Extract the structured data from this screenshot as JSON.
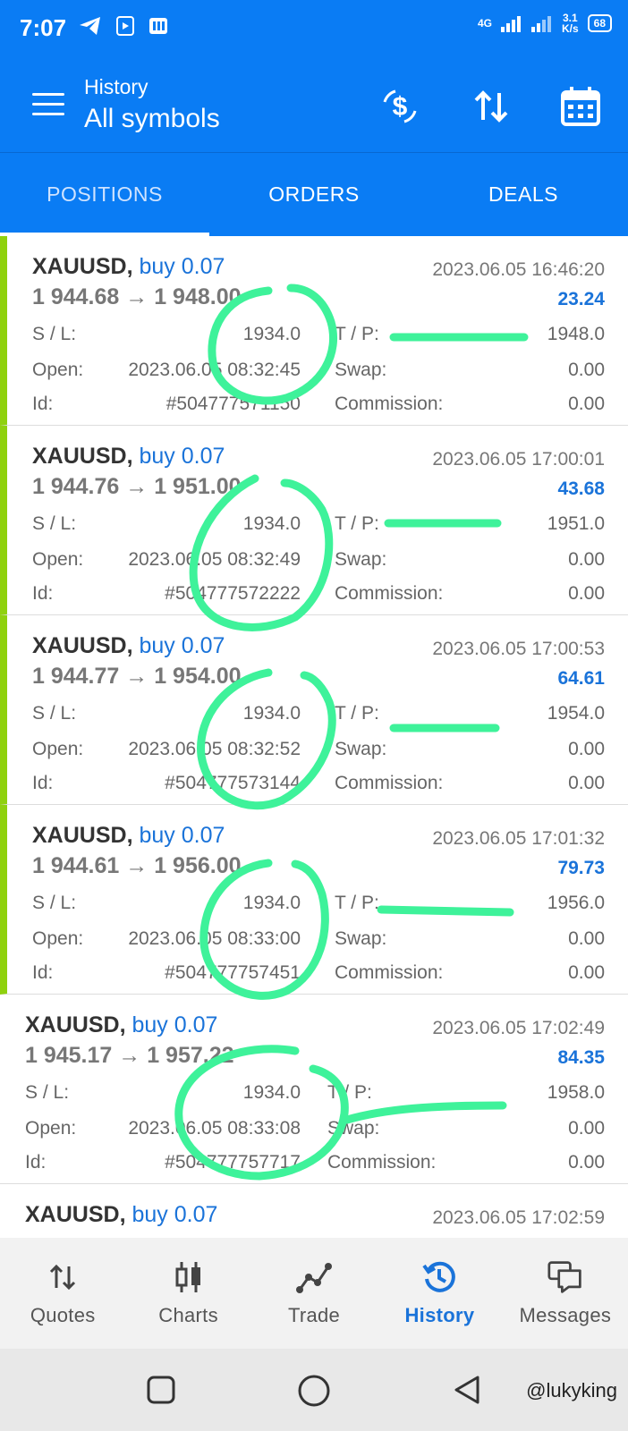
{
  "status_bar": {
    "time": "7:07",
    "signal": "4G",
    "net_speed_value": "3.1",
    "net_speed_unit": "K/s",
    "battery": "68"
  },
  "app_bar": {
    "subtitle": "History",
    "title": "All symbols"
  },
  "tabs": [
    {
      "label": "POSITIONS"
    },
    {
      "label": "ORDERS"
    },
    {
      "label": "DEALS"
    }
  ],
  "labels": {
    "sl": "S / L:",
    "tp": "T / P:",
    "open": "Open:",
    "swap": "Swap:",
    "id": "Id:",
    "commission": "Commission:"
  },
  "positions": [
    {
      "symbol": "XAUUSD,",
      "direction": "buy 0.07",
      "close_date": "2023.06.05 16:46:20",
      "prices": "1 944.68 → 1 948.00",
      "profit": "23.24",
      "sl": "1934.0",
      "tp": "1948.0",
      "open": "2023.06.05 08:32:45",
      "swap": "0.00",
      "id": "#504777571150",
      "commission": "0.00"
    },
    {
      "symbol": "XAUUSD,",
      "direction": "buy 0.07",
      "close_date": "2023.06.05 17:00:01",
      "prices": "1 944.76 → 1 951.00",
      "profit": "43.68",
      "sl": "1934.0",
      "tp": "1951.0",
      "open": "2023.06.05 08:32:49",
      "swap": "0.00",
      "id": "#504777572222",
      "commission": "0.00"
    },
    {
      "symbol": "XAUUSD,",
      "direction": "buy 0.07",
      "close_date": "2023.06.05 17:00:53",
      "prices": "1 944.77 → 1 954.00",
      "profit": "64.61",
      "sl": "1934.0",
      "tp": "1954.0",
      "open": "2023.06.05 08:32:52",
      "swap": "0.00",
      "id": "#504777573144",
      "commission": "0.00"
    },
    {
      "symbol": "XAUUSD,",
      "direction": "buy 0.07",
      "close_date": "2023.06.05 17:01:32",
      "prices": "1 944.61 → 1 956.00",
      "profit": "79.73",
      "sl": "1934.0",
      "tp": "1956.0",
      "open": "2023.06.05 08:33:00",
      "swap": "0.00",
      "id": "#504777757451",
      "commission": "0.00"
    },
    {
      "symbol": "XAUUSD,",
      "direction": "buy 0.07",
      "close_date": "2023.06.05 17:02:49",
      "prices": "1 945.17 → 1 957.22",
      "profit": "84.35",
      "sl": "1934.0",
      "tp": "1958.0",
      "open": "2023.06.05 08:33:08",
      "swap": "0.00",
      "id": "#504777757717",
      "commission": "0.00"
    },
    {
      "symbol": "XAUUSD,",
      "direction": "buy 0.07",
      "close_date": "2023.06.05 17:02:59"
    }
  ],
  "bottom_nav": [
    {
      "label": "Quotes",
      "icon": "quotes-arrows-icon"
    },
    {
      "label": "Charts",
      "icon": "candlestick-icon"
    },
    {
      "label": "Trade",
      "icon": "trade-line-icon"
    },
    {
      "label": "History",
      "icon": "history-clock-icon"
    },
    {
      "label": "Messages",
      "icon": "messages-icon"
    }
  ],
  "watermark": "@lukyking",
  "colors": {
    "header_blue": "#0a7cf4",
    "accent_blue": "#1a73d9",
    "marker_green": "#8fd10e",
    "annotation_green": "#3ef29a"
  }
}
